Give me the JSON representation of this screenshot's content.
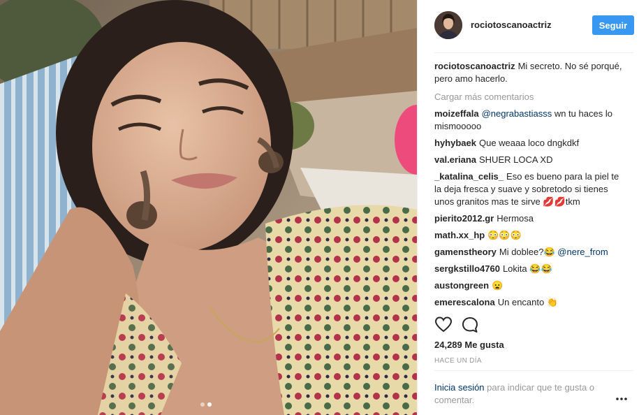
{
  "post": {
    "photo": {
      "description_icon": "photo",
      "carousel": {
        "total": 2,
        "active": 2
      }
    },
    "header": {
      "username": "rociotoscanoactriz",
      "follow_label": "Seguir"
    },
    "caption": {
      "user": "rociotoscanoactriz",
      "text": "Mi secreto. No sé porqué, pero amo hacerlo."
    },
    "load_more": "Cargar más comentarios",
    "comments": [
      {
        "user": "moizeffala",
        "mention": "@negrabastiasss",
        "text": " wn tu haces lo mismooooo"
      },
      {
        "user": "hyhybaek",
        "mention": "",
        "text": "Que weaaa loco dngkdkf"
      },
      {
        "user": "val.eriana",
        "mention": "",
        "text": "SHUER LOCA XD"
      },
      {
        "user": "_katalina_celis_",
        "mention": "",
        "text": "Eso es bueno para la piel te la deja fresca y suave y sobretodo si tienes unos granitos mas te sirve 💋💋tkm"
      },
      {
        "user": "pierito2012.gr",
        "mention": "",
        "text": "Hermosa"
      },
      {
        "user": "math.xx_hp",
        "mention": "",
        "text": "😳😳😳"
      },
      {
        "user": "gamenstheory",
        "mention": "",
        "text": "Mi doblee?😂 ",
        "mention_after": "@nere_from"
      },
      {
        "user": "sergkstillo4760",
        "mention": "",
        "text": "Lokita 😂😂"
      },
      {
        "user": "austongreen",
        "mention": "",
        "text": "😦"
      },
      {
        "user": "emerescalona",
        "mention": "",
        "text": "Un encanto 👏"
      }
    ],
    "actions": {
      "like_icon": "heart-icon",
      "comment_icon": "comment-bubble-icon"
    },
    "likes_text": "24,289 Me gusta",
    "timestamp": "HACE UN DÍA",
    "login": {
      "link": "Inicia sesión",
      "rest": " para indicar que te gusta o comentar."
    },
    "more_icon": "ellipsis-icon",
    "colors": {
      "follow_button": "#3897f0",
      "link": "#003569",
      "muted": "#999999"
    }
  }
}
